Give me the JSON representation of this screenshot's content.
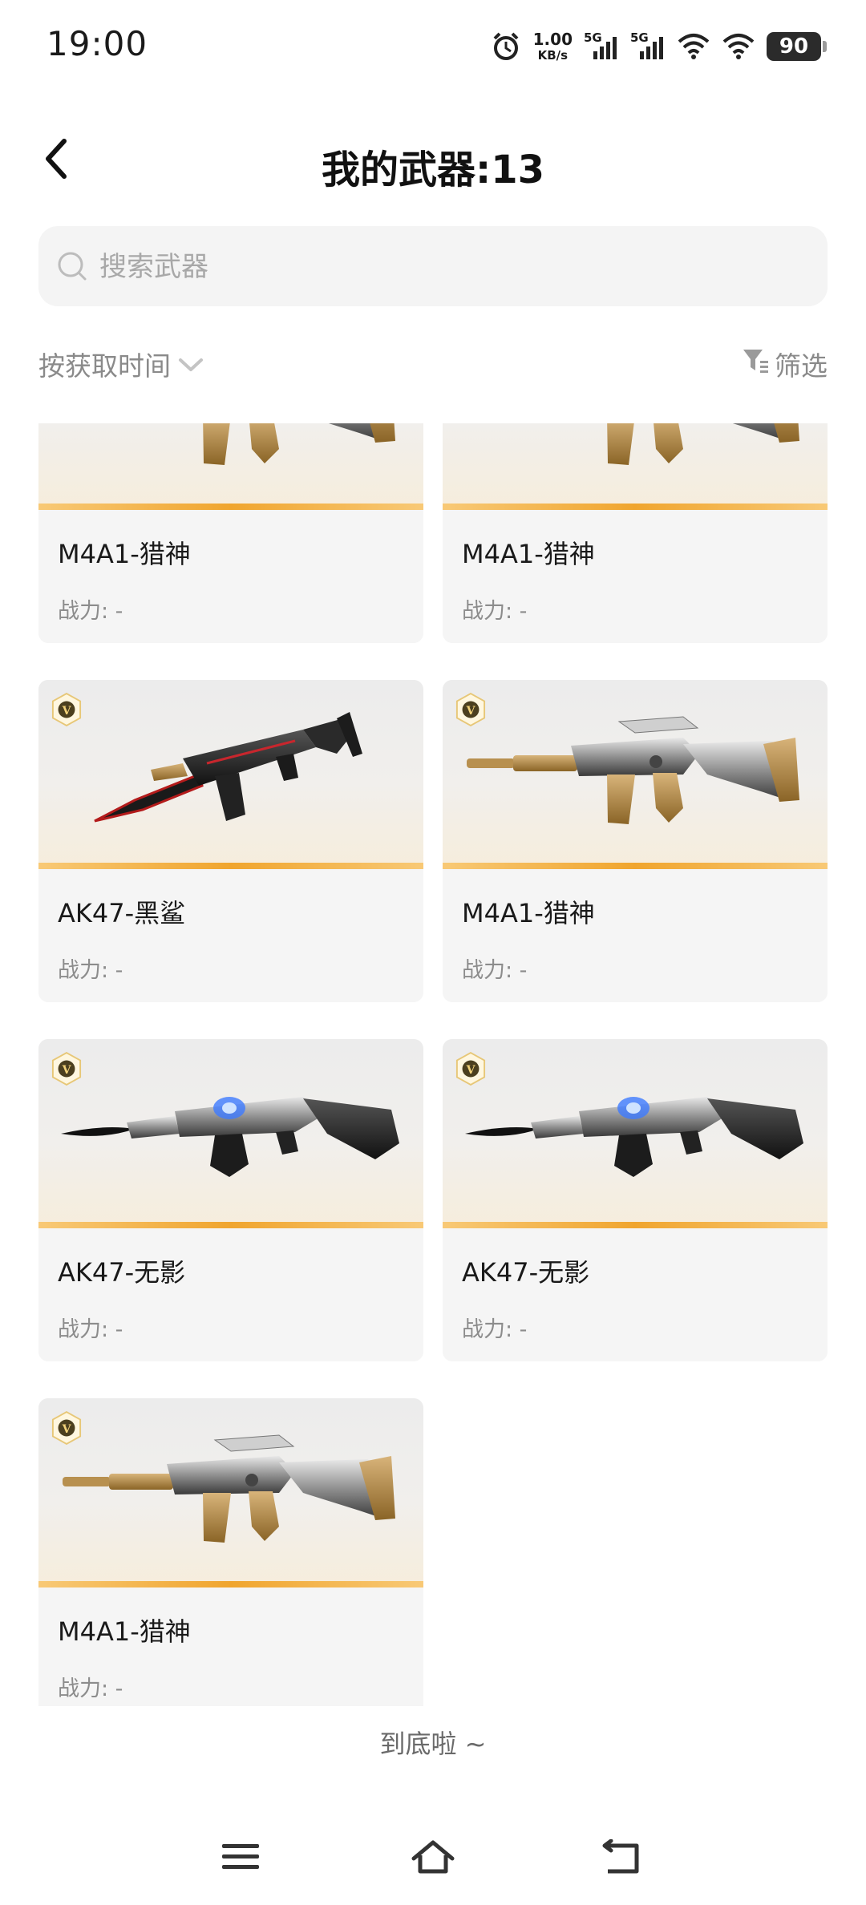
{
  "status_bar": {
    "time": "19:00",
    "net_speed_value": "1.00",
    "net_speed_unit": "KB/s",
    "sim1_label": "5G",
    "sim2_label": "5G",
    "battery": "90",
    "icons": [
      "alarm-icon",
      "signal-5g-icon",
      "signal-5g-icon",
      "wifi-icon",
      "wifi-icon",
      "battery-icon"
    ]
  },
  "header": {
    "back_icon": "chevron-left-icon",
    "title": "我的武器:13"
  },
  "search": {
    "placeholder": "搜索武器",
    "value": ""
  },
  "sort": {
    "label": "按获取时间",
    "icon": "chevron-down-icon"
  },
  "filter": {
    "label": "筛选",
    "icon": "filter-icon"
  },
  "weapons": [
    {
      "name": "M4A1-猎神",
      "power": "战力: -"
    },
    {
      "name": "M4A1-猎神",
      "power": "战力: -"
    },
    {
      "name": "AK47-黑鲨",
      "power": "战力: -"
    },
    {
      "name": "M4A1-猎神",
      "power": "战力: -"
    },
    {
      "name": "AK47-无影",
      "power": "战力: -"
    },
    {
      "name": "AK47-无影",
      "power": "战力: -"
    },
    {
      "name": "M4A1-猎神",
      "power": "战力: -"
    }
  ],
  "badge_letter": "V",
  "end_text": "到底啦 ~",
  "nav_bar": {
    "icons": [
      "menu-icon",
      "home-icon",
      "back-icon"
    ]
  },
  "colors": {
    "accent_stripe": "#f0a52e",
    "card_bg": "#f5f5f5",
    "search_bg": "#f4f4f4",
    "muted_text": "#8a8a8a"
  }
}
